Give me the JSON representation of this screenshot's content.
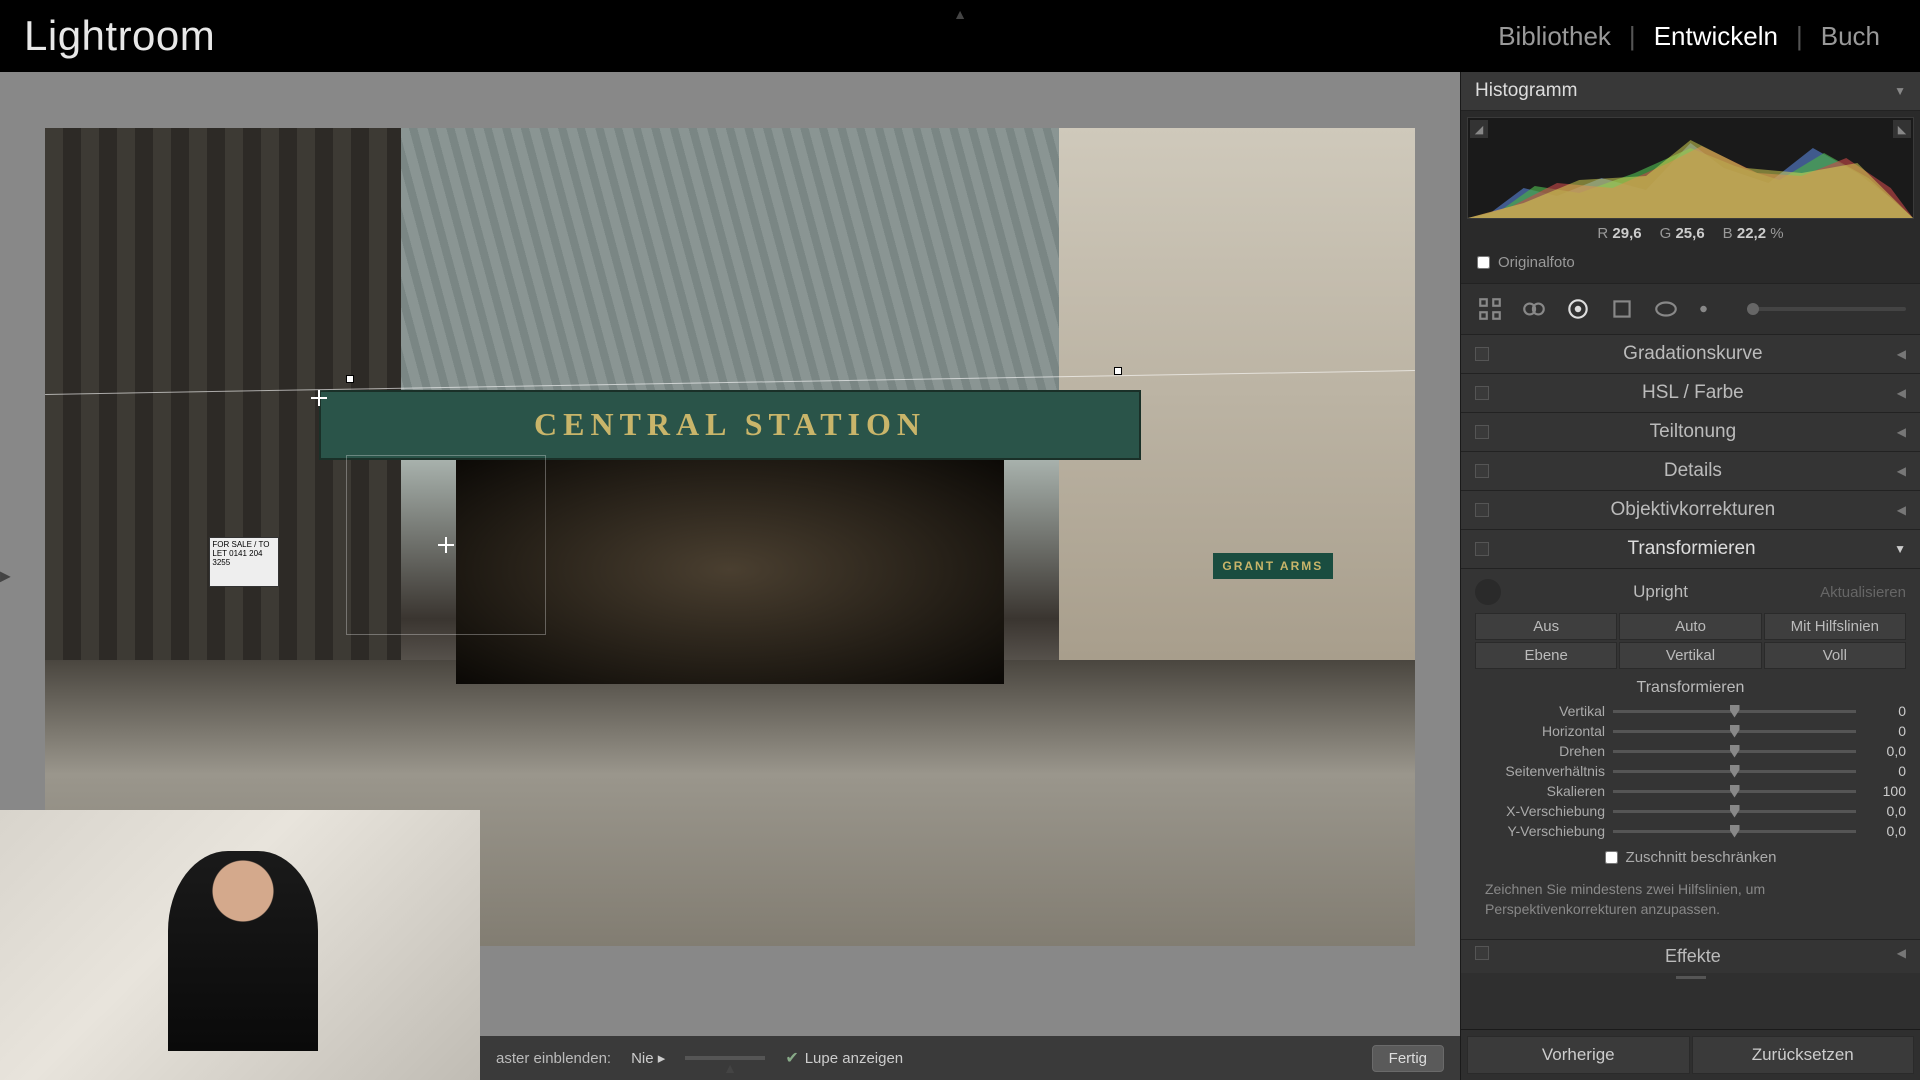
{
  "app_title": "Lightroom",
  "modules": {
    "library": "Bibliothek",
    "develop": "Entwickeln",
    "book": "Buch",
    "active": "develop"
  },
  "histogram": {
    "title": "Histogramm",
    "rgb": {
      "r_label": "R",
      "r": "29,6",
      "g_label": "G",
      "g": "25,6",
      "b_label": "B",
      "b": "22,2",
      "pct": "%"
    },
    "original_label": "Originalfoto"
  },
  "photo": {
    "sign_main": "CENTRAL STATION",
    "sign_right": "GRANT ARMS",
    "sign_left": "FOR SALE / TO LET 0141 204 3255"
  },
  "panels": {
    "tone_curve": "Gradationskurve",
    "hsl": "HSL / Farbe",
    "split": "Teiltonung",
    "detail": "Details",
    "lens": "Objektivkorrekturen",
    "transform": "Transformieren",
    "effects": "Effekte"
  },
  "transform": {
    "upright_label": "Upright",
    "update": "Aktualisieren",
    "buttons": {
      "off": "Aus",
      "auto": "Auto",
      "guided": "Mit Hilfslinien",
      "level": "Ebene",
      "vertical": "Vertikal",
      "full": "Voll"
    },
    "section_label": "Transformieren",
    "sliders": [
      {
        "label": "Vertikal",
        "value": "0"
      },
      {
        "label": "Horizontal",
        "value": "0"
      },
      {
        "label": "Drehen",
        "value": "0,0"
      },
      {
        "label": "Seitenverhältnis",
        "value": "0"
      },
      {
        "label": "Skalieren",
        "value": "100"
      },
      {
        "label": "X-Verschiebung",
        "value": "0,0"
      },
      {
        "label": "Y-Verschiebung",
        "value": "0,0"
      }
    ],
    "constrain": "Zuschnitt beschränken",
    "hint": "Zeichnen Sie mindestens zwei Hilfslinien, um Perspektivenkorrekturen anzupassen."
  },
  "bottom_toolbar": {
    "grid_label": "aster einblenden:",
    "grid_value": "Nie",
    "loupe_label": "Lupe anzeigen",
    "done": "Fertig"
  },
  "panel_footer": {
    "previous": "Vorherige",
    "reset": "Zurücksetzen"
  }
}
